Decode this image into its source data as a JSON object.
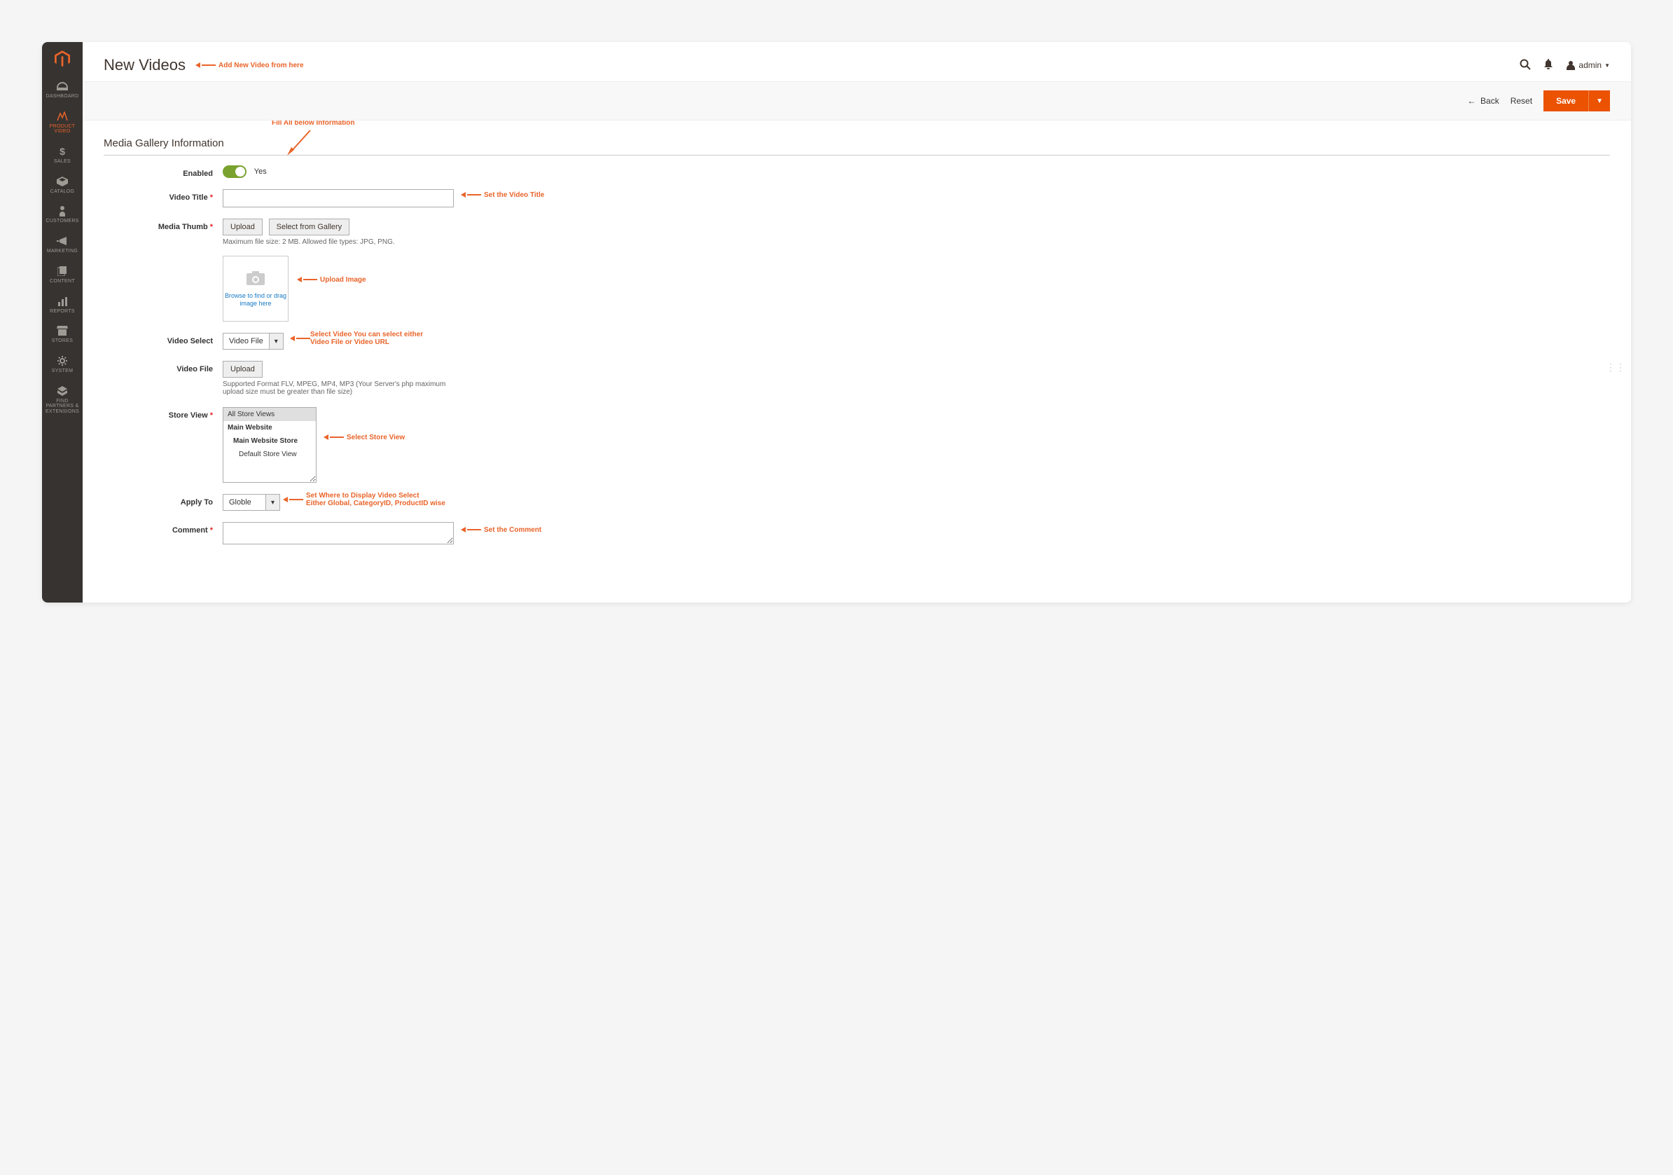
{
  "sidebar": {
    "items": [
      {
        "label": "DASHBOARD"
      },
      {
        "label": "PRODUCT VIDEO"
      },
      {
        "label": "SALES"
      },
      {
        "label": "CATALOG"
      },
      {
        "label": "CUSTOMERS"
      },
      {
        "label": "MARKETING"
      },
      {
        "label": "CONTENT"
      },
      {
        "label": "REPORTS"
      },
      {
        "label": "STORES"
      },
      {
        "label": "SYSTEM"
      },
      {
        "label": "FIND PARTNERS & EXTENSIONS"
      }
    ]
  },
  "header": {
    "title": "New Videos",
    "user": "admin"
  },
  "toolbar": {
    "back": "Back",
    "reset": "Reset",
    "save": "Save"
  },
  "section": {
    "title": "Media Gallery Information"
  },
  "form": {
    "enabled": {
      "label": "Enabled",
      "value": "Yes"
    },
    "video_title": {
      "label": "Video Title"
    },
    "media_thumb": {
      "label": "Media Thumb",
      "upload": "Upload",
      "select_gallery": "Select from Gallery",
      "hint": "Maximum file size: 2 MB. Allowed file types: JPG, PNG.",
      "dropzone": "Browse to find or drag image here"
    },
    "video_select": {
      "label": "Video Select",
      "value": "Video File"
    },
    "video_file": {
      "label": "Video File",
      "upload": "Upload",
      "hint": "Supported Format FLV, MPEG, MP4, MP3 (Your Server's php maximum upload size must be greater than file size)"
    },
    "store_view": {
      "label": "Store View",
      "options": [
        "All Store Views",
        "Main Website",
        "Main Website Store",
        "Default Store View"
      ]
    },
    "apply_to": {
      "label": "Apply To",
      "value": "Globle"
    },
    "comment": {
      "label": "Comment"
    }
  },
  "annotations": {
    "add_new": "Add New Video from here",
    "fill_below": "Fill All below Information",
    "set_title": "Set the Video Title",
    "upload_image": "Upload Image",
    "select_video_l1": "Select Video You can select either",
    "select_video_l2": "Video File or Video URL",
    "select_store": "Select Store View",
    "set_where_l1": "Set Where to Display Video Select",
    "set_where_l2": "Either Global, CategoryID, ProductID wise",
    "set_comment": "Set the Comment"
  }
}
